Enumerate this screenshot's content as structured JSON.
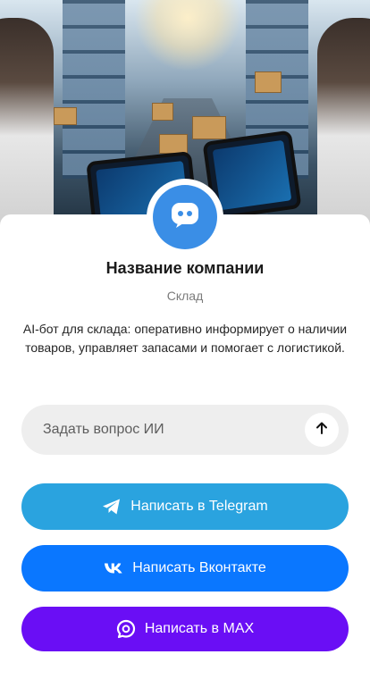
{
  "colors": {
    "avatar_bg": "#3a8ee6",
    "telegram": "#2aa3df",
    "vk": "#0a77ff",
    "max": "#6a0ef5",
    "ask_bg": "#eeeeee"
  },
  "hero": {
    "image": "warehouse-robots-illustration"
  },
  "company": {
    "avatar_icon": "chat-bot-icon",
    "name": "Название компании",
    "category": "Склад",
    "description": "AI-бот для склада: оперативно информирует о наличии товаров, управляет запасами и помогает с логистикой."
  },
  "ask": {
    "placeholder": "Задать вопрос ИИ",
    "send_icon": "arrow-up-icon"
  },
  "buttons": {
    "telegram": {
      "label": "Написать в Telegram",
      "icon": "telegram-icon"
    },
    "vk": {
      "label": "Написать Вконтакте",
      "icon": "vk-icon"
    },
    "max": {
      "label": "Написать в MAX",
      "icon": "max-icon"
    }
  }
}
